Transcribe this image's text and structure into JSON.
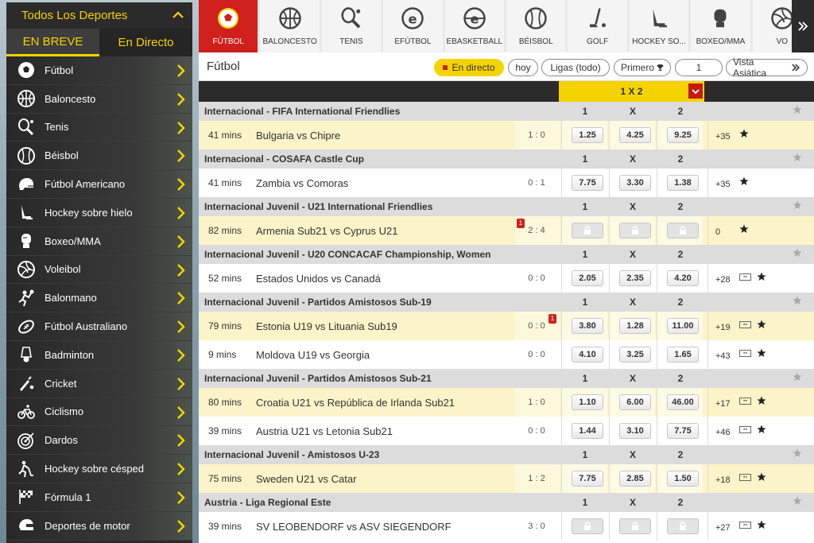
{
  "sidebar": {
    "title": "Todos Los Deportes",
    "tabs": [
      "EN BREVE",
      "En Directo"
    ],
    "items": [
      {
        "label": "Fútbol",
        "icon": "soccer-ball-icon"
      },
      {
        "label": "Baloncesto",
        "icon": "basketball-icon"
      },
      {
        "label": "Tenis",
        "icon": "tennis-racket-icon"
      },
      {
        "label": "Béisbol",
        "icon": "baseball-icon"
      },
      {
        "label": "Fútbol Americano",
        "icon": "football-helmet-icon"
      },
      {
        "label": "Hockey sobre hielo",
        "icon": "ice-hockey-icon"
      },
      {
        "label": "Boxeo/MMA",
        "icon": "boxing-glove-icon"
      },
      {
        "label": "Voleibol",
        "icon": "volleyball-icon"
      },
      {
        "label": "Balonmano",
        "icon": "handball-icon"
      },
      {
        "label": "Fútbol Australiano",
        "icon": "aussie-football-icon"
      },
      {
        "label": "Badminton",
        "icon": "shuttlecock-icon"
      },
      {
        "label": "Cricket",
        "icon": "cricket-icon"
      },
      {
        "label": "Ciclismo",
        "icon": "bicycle-icon"
      },
      {
        "label": "Dardos",
        "icon": "dartboard-icon"
      },
      {
        "label": "Hockey sobre césped",
        "icon": "field-hockey-icon"
      },
      {
        "label": "Fórmula 1",
        "icon": "race-flag-icon"
      },
      {
        "label": "Deportes de motor",
        "icon": "motor-helmet-icon"
      }
    ]
  },
  "sports": [
    {
      "label": "FÚTBOL",
      "icon": "soccer-ball-icon",
      "active": true
    },
    {
      "label": "BALONCESTO",
      "icon": "basketball-icon"
    },
    {
      "label": "TENIS",
      "icon": "tennis-racket-icon"
    },
    {
      "label": "EFÚTBOL",
      "icon": "efootball-icon"
    },
    {
      "label": "EBASKETBALL",
      "icon": "ebasketball-icon"
    },
    {
      "label": "BÉISBOL",
      "icon": "baseball-icon"
    },
    {
      "label": "GOLF",
      "icon": "golf-club-icon"
    },
    {
      "label": "HOCKEY SO...",
      "icon": "ice-hockey-icon"
    },
    {
      "label": "BOXEO/MMA",
      "icon": "boxing-glove-icon"
    },
    {
      "label": "VO",
      "icon": "volleyball-icon"
    }
  ],
  "toolbar": {
    "title": "Fútbol",
    "live": "En directo",
    "today": "hoy",
    "leagues": "Ligas (todo)",
    "first": "Primero",
    "count": "1",
    "view": "Vista Asiática"
  },
  "market": {
    "label": "1 X 2"
  },
  "headers": {
    "h1": "1",
    "hx": "X",
    "h2": "2"
  },
  "leagues": [
    {
      "name": "Internacional - FIFA International Friendlies",
      "events": [
        {
          "time": "41 mins",
          "teams": "Bulgaria vs Chipre",
          "score": "1 : 0",
          "o1": "1.25",
          "ox": "4.25",
          "o2": "9.25",
          "more": "+35",
          "tv": false,
          "hl": true
        }
      ]
    },
    {
      "name": "Internacional - COSAFA Castle Cup",
      "events": [
        {
          "time": "41 mins",
          "teams": "Zambia vs Comoras",
          "score": "0 : 1",
          "o1": "7.75",
          "ox": "3.30",
          "o2": "1.38",
          "more": "+35",
          "tv": false,
          "hl": false
        }
      ]
    },
    {
      "name": "Internacional Juvenil - U21 International Friendlies",
      "events": [
        {
          "time": "82 mins",
          "teams": "Armenia Sub21 vs Cyprus U21",
          "score": "2 : 4",
          "badge": "1",
          "badgeLeft": true,
          "locked": true,
          "more": "0",
          "tv": false,
          "hl": true
        }
      ]
    },
    {
      "name": "Internacional Juvenil - U20 CONCACAF Championship, Women",
      "events": [
        {
          "time": "52 mins",
          "teams": "Estados Unidos vs Canadá",
          "score": "0 : 0",
          "o1": "2.05",
          "ox": "2.35",
          "o2": "4.20",
          "more": "+28",
          "tv": true,
          "hl": false
        }
      ]
    },
    {
      "name": "Internacional Juvenil - Partidos Amistosos Sub-19",
      "events": [
        {
          "time": "79 mins",
          "teams": "Estonia U19 vs Lituania Sub19",
          "score": "0 : 0",
          "badge": "1",
          "o1": "3.80",
          "ox": "1.28",
          "o2": "11.00",
          "more": "+19",
          "tv": true,
          "hl": true
        },
        {
          "time": "9 mins",
          "teams": "Moldova U19 vs Georgia",
          "score": "0 : 0",
          "o1": "4.10",
          "ox": "3.25",
          "o2": "1.65",
          "more": "+43",
          "tv": true,
          "hl": false
        }
      ]
    },
    {
      "name": "Internacional Juvenil - Partidos Amistosos Sub-21",
      "events": [
        {
          "time": "80 mins",
          "teams": "Croatia U21 vs República de Irlanda Sub21",
          "score": "1 : 0",
          "o1": "1.10",
          "ox": "6.00",
          "o2": "46.00",
          "more": "+17",
          "tv": true,
          "hl": true
        },
        {
          "time": "39 mins",
          "teams": "Austria U21 vs Letonia Sub21",
          "score": "0 : 0",
          "o1": "1.44",
          "ox": "3.10",
          "o2": "7.75",
          "more": "+46",
          "tv": true,
          "hl": false
        }
      ]
    },
    {
      "name": "Internacional Juvenil - Amistosos U-23",
      "events": [
        {
          "time": "75 mins",
          "teams": "Sweden U21 vs Catar",
          "score": "1 : 2",
          "o1": "7.75",
          "ox": "2.85",
          "o2": "1.50",
          "more": "+18",
          "tv": true,
          "hl": true
        }
      ]
    },
    {
      "name": "Austria - Liga Regional Este",
      "events": [
        {
          "time": "39 mins",
          "teams": "SV LEOBENDORF vs ASV SIEGENDORF",
          "score": "3 : 0",
          "locked": true,
          "more": "+27",
          "tv": true,
          "hl": false
        }
      ]
    }
  ],
  "colors": {
    "accent": "#f5d300",
    "brand_red": "#d0201c",
    "dark": "#2b2b2b"
  }
}
